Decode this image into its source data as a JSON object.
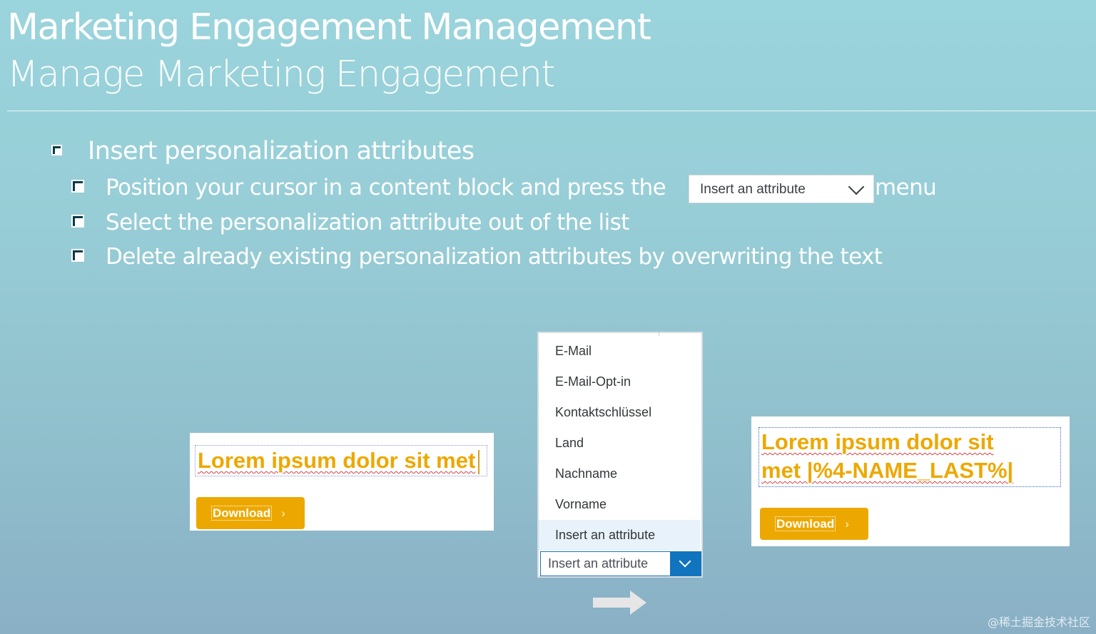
{
  "header": {
    "title": "Marketing Engagement Management",
    "subtitle": "Manage Marketing Engagement"
  },
  "bullets": {
    "main": "Insert personalization attributes",
    "step1_before": "Position your cursor in a content block and press the",
    "step1_select": "Insert an attribute",
    "step1_after": "menu",
    "step2": "Select the personalization attribute out of the list",
    "step3": "Delete already existing personalization attributes by overwriting the text"
  },
  "preview_before": {
    "text": "Lorem ipsum dolor sit met",
    "button_label": "Download",
    "button_arrow": "›"
  },
  "dropdown": {
    "items": [
      "E-Mail",
      "E-Mail-Opt-in",
      "Kontaktschlüssel",
      "Land",
      "Nachname",
      "Vorname",
      "Insert an attribute"
    ],
    "highlighted_item": "Insert an attribute",
    "field_value": "Insert an attribute"
  },
  "preview_after": {
    "line1": "Lorem ipsum dolor sit",
    "line2": "met |%4-NAME_LAST%|",
    "button_label": "Download",
    "button_arrow": "›"
  },
  "watermark": "@稀土掘金技术社区",
  "colors": {
    "accent_orange": "#eda800",
    "select_blue": "#1074bf",
    "background_top": "#9ad4dc",
    "background_bottom": "#8ab0c6"
  },
  "icons": {
    "dropdown_chevron": "chevron-down-icon",
    "flow_arrow": "arrow-right-icon",
    "bullet": "checkbox-icon"
  }
}
